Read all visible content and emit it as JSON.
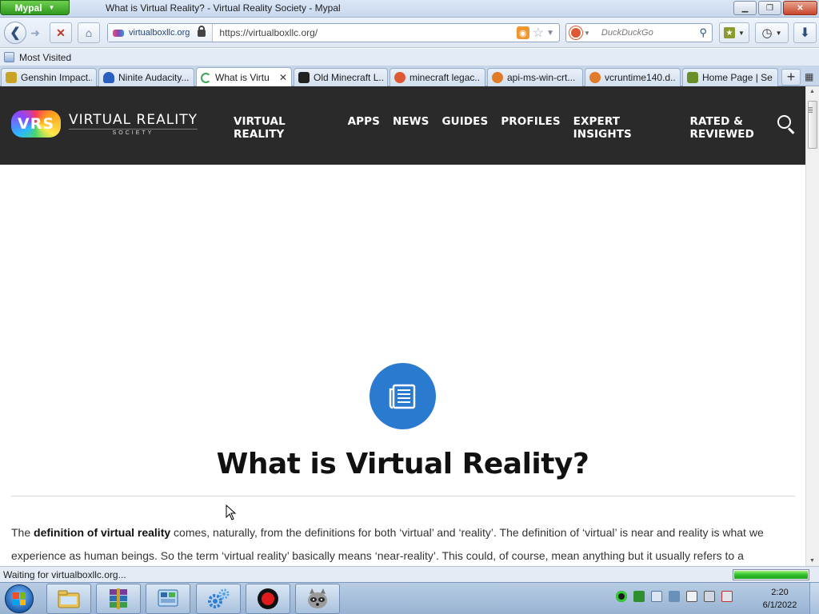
{
  "window": {
    "app_button": "Mypal",
    "title": "What is Virtual Reality? - Virtual Reality Society - Mypal"
  },
  "navbar": {
    "identity_domain": "virtualboxllc.org",
    "url": "https://virtualboxllc.org/",
    "search_placeholder": "DuckDuckGo"
  },
  "bookmarks": {
    "items": [
      {
        "label": "Most Visited"
      }
    ]
  },
  "tabs": [
    {
      "label": "Genshin Impact...",
      "favicon_color": "#c9a227"
    },
    {
      "label": "Ninite Audacity...",
      "favicon_color": "#2a5fbf"
    },
    {
      "label": "What is Virtu...",
      "favicon_color": "#3ba456"
    },
    {
      "label": "Old Minecraft L...",
      "favicon_color": "#222222"
    },
    {
      "label": "minecraft legac...",
      "favicon_color": "#de5833"
    },
    {
      "label": "api-ms-win-crt...",
      "favicon_color": "#e07b2a"
    },
    {
      "label": "vcruntime140.d...",
      "favicon_color": "#e07b2a"
    },
    {
      "label": "Home Page | Se...",
      "favicon_color": "#6a8f2a"
    }
  ],
  "site": {
    "logo_mark": "VRS",
    "logo_title": "VIRTUAL REALITY",
    "logo_sub": "SOCIETY",
    "nav": [
      "VIRTUAL REALITY",
      "APPS",
      "NEWS",
      "GUIDES",
      "PROFILES",
      "EXPERT INSIGHTS",
      "RATED & REVIEWED"
    ],
    "accent_color": "#2a7ad0",
    "header_color": "#2a2a2a"
  },
  "article": {
    "title": "What is Virtual Reality?",
    "intro_prefix": "The ",
    "intro_bold": "definition of virtual reality",
    "intro_rest": " comes, naturally, from the definitions for both ‘virtual’ and ‘reality’. The definition of ‘virtual’ is near and reality is what we experience as human beings. So the term ‘virtual reality’ basically means ‘near-reality’. This could, of course, mean anything but it usually refers to a"
  },
  "status": {
    "text": "Waiting for virtualboxllc.org...",
    "progress_fraction": 1.0
  },
  "taskbar": {
    "items": [
      "explorer-icon",
      "winrar-icon",
      "control-panel-icon",
      "settings-gears-icon",
      "record-icon",
      "raccoon-app-icon"
    ],
    "clock_time": "2:20",
    "clock_date": "6/1/2022"
  }
}
